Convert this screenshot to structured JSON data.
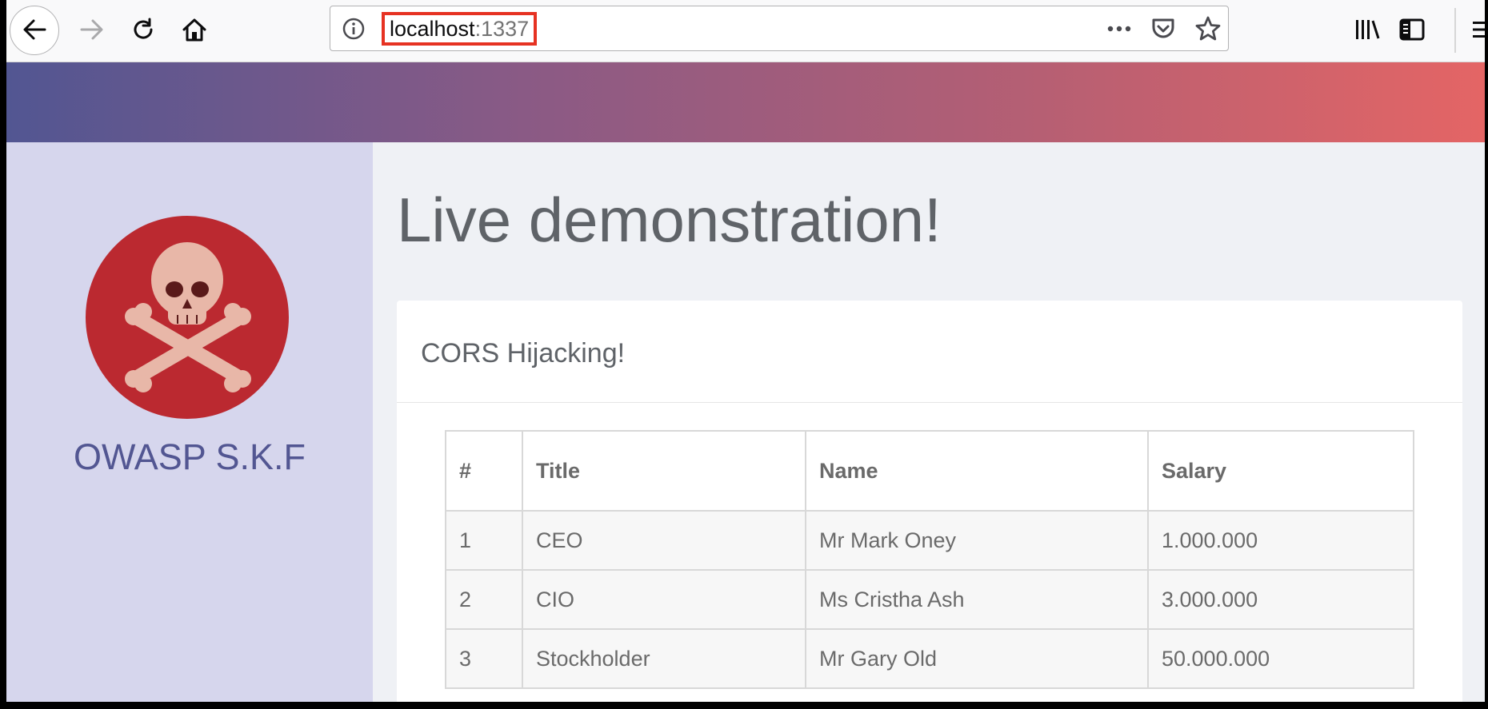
{
  "browser": {
    "url_host": "localhost",
    "url_port": ":1337",
    "icons": [
      "back-arrow-icon",
      "forward-arrow-icon",
      "reload-icon",
      "home-icon",
      "site-info-icon",
      "page-actions-icon",
      "pocket-icon",
      "bookmark-star-icon",
      "library-icon",
      "sidebar-icon",
      "menu-icon"
    ],
    "highlight_color": "#e63222"
  },
  "sidebar": {
    "brand": "OWASP S.K.F",
    "logo": "skull-crossbones-icon",
    "background": "#d6d6ed",
    "brand_color": "#525692"
  },
  "banner": {
    "gradient_from": "#525692",
    "gradient_to": "#e46565"
  },
  "main": {
    "title": "Live demonstration!",
    "card": {
      "title": "CORS Hijacking!",
      "table": {
        "headers": [
          "#",
          "Title",
          "Name",
          "Salary"
        ],
        "rows": [
          [
            "1",
            "CEO",
            "Mr Mark Oney",
            "1.000.000"
          ],
          [
            "2",
            "CIO",
            "Ms Cristha Ash",
            "3.000.000"
          ],
          [
            "3",
            "Stockholder",
            "Mr Gary Old",
            "50.000.000"
          ]
        ]
      }
    }
  }
}
